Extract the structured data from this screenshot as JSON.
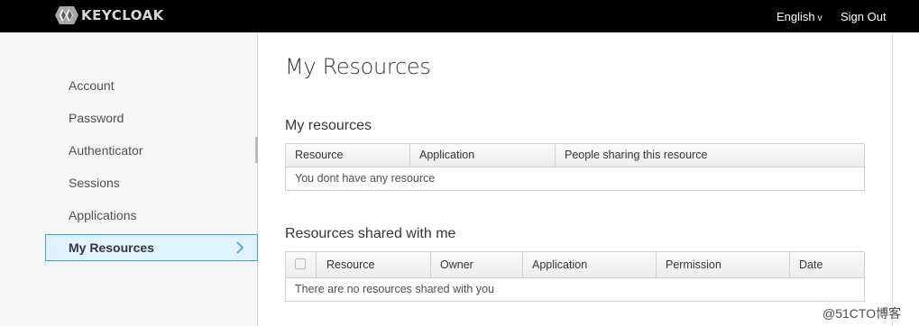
{
  "header": {
    "brand": "KEYCLOAK",
    "language_label": "English",
    "language_caret": "v",
    "signout_label": "Sign Out"
  },
  "sidebar": {
    "items": [
      {
        "label": "Account"
      },
      {
        "label": "Password"
      },
      {
        "label": "Authenticator"
      },
      {
        "label": "Sessions"
      },
      {
        "label": "Applications"
      },
      {
        "label": "My Resources"
      }
    ],
    "active_index": 5
  },
  "main": {
    "title": "My Resources",
    "my_resources": {
      "title": "My resources",
      "columns": [
        "Resource",
        "Application",
        "People sharing this resource"
      ],
      "empty_text": "You dont have any resource"
    },
    "shared_with_me": {
      "title": "Resources shared with me",
      "columns": [
        "Resource",
        "Owner",
        "Application",
        "Permission",
        "Date"
      ],
      "empty_text": "There are no resources shared with you"
    }
  },
  "watermark": "@51CTO博客",
  "colors": {
    "topbar": "#000000",
    "sidebar_bg": "#f6f6f6",
    "active_bg": "#def3ff",
    "active_border": "#39a5dc"
  }
}
